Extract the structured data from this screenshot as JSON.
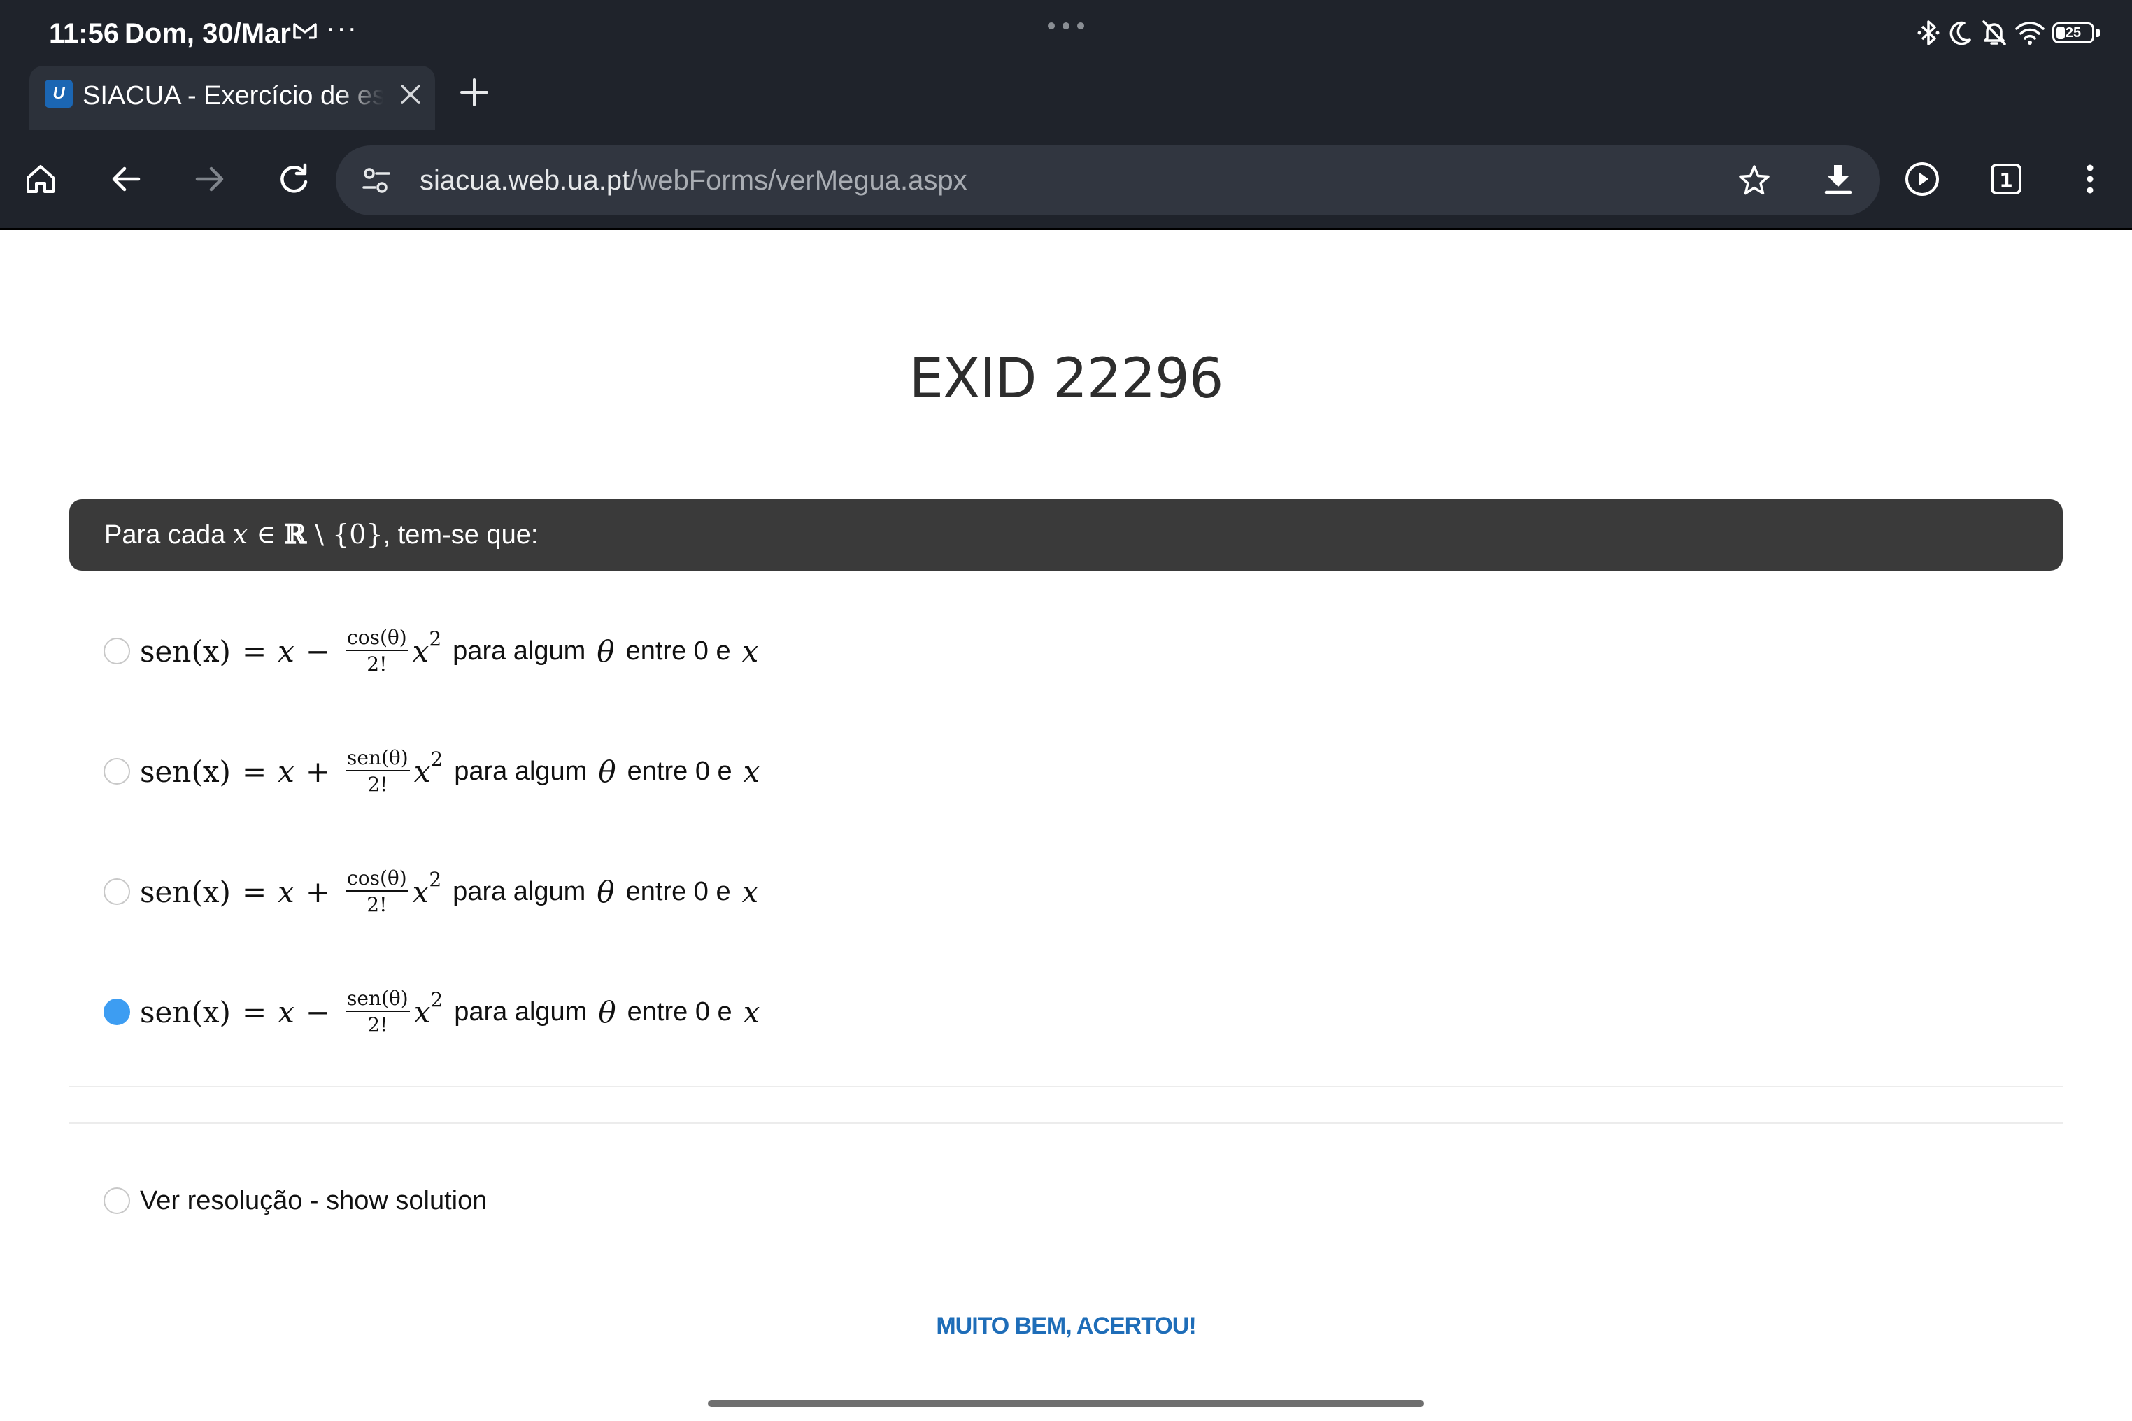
{
  "status_bar": {
    "time": "11:56",
    "date": "Dom, 30/Mar",
    "more": "···",
    "battery": "25"
  },
  "browser": {
    "tab_title": "SIACUA - Exercício de escolha múltipla",
    "favicon_letter": "U",
    "url_host": "siacua.web.ua.pt",
    "url_path": "/webForms/verMegua.aspx",
    "tab_count": "1"
  },
  "page": {
    "title": "EXID 22296",
    "question": {
      "prefix": "Para cada ",
      "var": "x",
      "elem": " ∈ ",
      "reals": "ℝ",
      "setminus": " \\ ",
      "set": "{0}",
      "suffix": ", tem-se que:"
    },
    "options": [
      {
        "sign": "−",
        "num": "cos(θ)",
        "den": "2!",
        "checked": false
      },
      {
        "sign": "+",
        "num": "sen(θ)",
        "den": "2!",
        "checked": false
      },
      {
        "sign": "+",
        "num": "cos(θ)",
        "den": "2!",
        "checked": false
      },
      {
        "sign": "−",
        "num": "sen(θ)",
        "den": "2!",
        "checked": true
      }
    ],
    "formula_parts": {
      "lhs": "sen",
      "lhs_arg": "(x)",
      "eq": "=",
      "x": "x",
      "pow_base": "x",
      "pow_exp": "2",
      "trail": "para algum",
      "theta": "θ",
      "between": "entre 0 e",
      "end_var": "x"
    },
    "solution_label": "Ver resolução - show solution",
    "result_message": "MUITO BEM, ACERTOU!"
  },
  "colors": {
    "chrome_bg": "#1f232b",
    "question_bg": "#3a3a3a",
    "radio_checked": "#3d9df2",
    "result_text": "#1e6db8"
  },
  "icons": [
    "home-icon",
    "back-icon",
    "forward-icon",
    "reload-icon",
    "tune-icon",
    "star-icon",
    "download-icon",
    "play-icon",
    "tab-count-icon",
    "more-vert-icon",
    "close-icon",
    "plus-icon",
    "bluetooth-icon",
    "moon-icon",
    "bell-off-icon",
    "wifi-icon",
    "battery-icon",
    "mail-icon"
  ]
}
